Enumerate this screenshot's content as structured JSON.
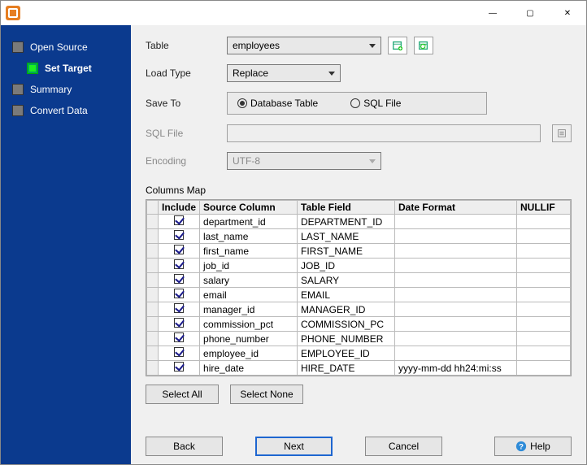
{
  "window": {
    "min_icon": "—",
    "max_icon": "▢",
    "close_icon": "✕"
  },
  "sidebar": {
    "steps": [
      {
        "label": "Open Source"
      },
      {
        "label": "Set Target"
      },
      {
        "label": "Summary"
      },
      {
        "label": "Convert Data"
      }
    ]
  },
  "form": {
    "table_label": "Table",
    "table_value": "employees",
    "loadtype_label": "Load Type",
    "loadtype_value": "Replace",
    "saveto_label": "Save To",
    "saveto_db": "Database Table",
    "saveto_sql": "SQL File",
    "sqlfile_label": "SQL File",
    "sqlfile_value": "",
    "encoding_label": "Encoding",
    "encoding_value": "UTF-8",
    "columnsmap_label": "Columns Map"
  },
  "columns": {
    "headers": {
      "include": "Include",
      "source": "Source Column",
      "field": "Table Field",
      "datefmt": "Date Format",
      "nullif": "NULLIF"
    },
    "rows": [
      {
        "include": true,
        "source": "department_id",
        "field": "DEPARTMENT_ID",
        "datefmt": "",
        "nullif": ""
      },
      {
        "include": true,
        "source": "last_name",
        "field": "LAST_NAME",
        "datefmt": "",
        "nullif": ""
      },
      {
        "include": true,
        "source": "first_name",
        "field": "FIRST_NAME",
        "datefmt": "",
        "nullif": ""
      },
      {
        "include": true,
        "source": "job_id",
        "field": "JOB_ID",
        "datefmt": "",
        "nullif": ""
      },
      {
        "include": true,
        "source": "salary",
        "field": "SALARY",
        "datefmt": "",
        "nullif": ""
      },
      {
        "include": true,
        "source": "email",
        "field": "EMAIL",
        "datefmt": "",
        "nullif": ""
      },
      {
        "include": true,
        "source": "manager_id",
        "field": "MANAGER_ID",
        "datefmt": "",
        "nullif": ""
      },
      {
        "include": true,
        "source": "commission_pct",
        "field": "COMMISSION_PC",
        "datefmt": "",
        "nullif": ""
      },
      {
        "include": true,
        "source": "phone_number",
        "field": "PHONE_NUMBER",
        "datefmt": "",
        "nullif": ""
      },
      {
        "include": true,
        "source": "employee_id",
        "field": "EMPLOYEE_ID",
        "datefmt": "",
        "nullif": ""
      },
      {
        "include": true,
        "source": "hire_date",
        "field": "HIRE_DATE",
        "datefmt": "yyyy-mm-dd hh24:mi:ss",
        "nullif": ""
      }
    ]
  },
  "buttons": {
    "select_all": "Select All",
    "select_none": "Select None",
    "back": "Back",
    "next": "Next",
    "cancel": "Cancel",
    "help": "Help"
  }
}
